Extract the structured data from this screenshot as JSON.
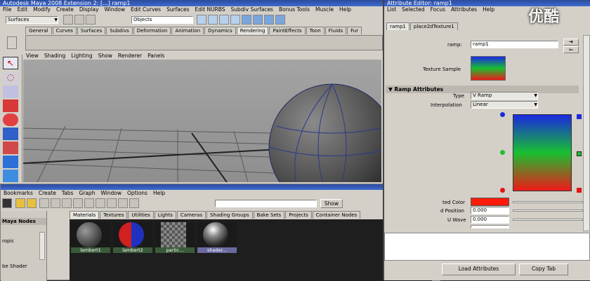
{
  "maya": {
    "title": "Autodesk Maya 2008 Extension 2: [...]  ramp1",
    "menus": [
      "File",
      "Edit",
      "Modify",
      "Create",
      "Display",
      "Window",
      "Edit Curves",
      "Surfaces",
      "Edit NURBS",
      "Subdiv Surfaces",
      "Bonus Tools",
      "Muscle",
      "Help"
    ],
    "menuset": "Surfaces",
    "selection_field": "Objects",
    "shelf_tabs": [
      "General",
      "Curves",
      "Surfaces",
      "Subdivs",
      "Deformation",
      "Animation",
      "Dynamics",
      "Rendering",
      "PaintEffects",
      "Toon",
      "Fluids",
      "Fur"
    ],
    "viewport_menus": [
      "View",
      "Shading",
      "Lighting",
      "Show",
      "Renderer",
      "Panels"
    ]
  },
  "hypershade": {
    "menus": [
      "Bookmarks",
      "Create",
      "Tabs",
      "Graph",
      "Window",
      "Options",
      "Help"
    ],
    "show_button": "Show",
    "tabs": [
      "Materials",
      "Textures",
      "Utilities",
      "Lights",
      "Cameras",
      "Shading Groups",
      "Bake Sets",
      "Projects",
      "Container Nodes"
    ],
    "left_labels": [
      "Maya Nodes",
      "ropic",
      "be Shader"
    ],
    "swatches": [
      {
        "label": "lambert1",
        "kind": "lambert1"
      },
      {
        "label": "lambert2",
        "kind": "lambert2"
      },
      {
        "label": "partic...",
        "kind": "particle"
      },
      {
        "label": "shader...",
        "kind": "shader"
      }
    ]
  },
  "attribute_editor": {
    "title": "Attribute Editor: ramp1",
    "menus": [
      "List",
      "Selected",
      "Focus",
      "Attributes",
      "Help"
    ],
    "tabs": [
      "ramp1",
      "place2dTexture1"
    ],
    "node_label": "ramp:",
    "node_value": "ramp1",
    "texture_sample_label": "Texture Sample",
    "section_title": "Ramp Attributes",
    "type_label": "Type",
    "type_value": "V Ramp",
    "interpolation_label": "Interpolation",
    "interpolation_value": "Linear",
    "selected_color_label": "ted Color",
    "selected_color": "#ff1a0a",
    "position_label": "d Position",
    "position_value": "0.000",
    "uwave_label": "U Wave",
    "uwave_value": "0.000",
    "load_button": "Load Attributes",
    "copy_button": "Copy Tab"
  },
  "watermark": "优酷"
}
